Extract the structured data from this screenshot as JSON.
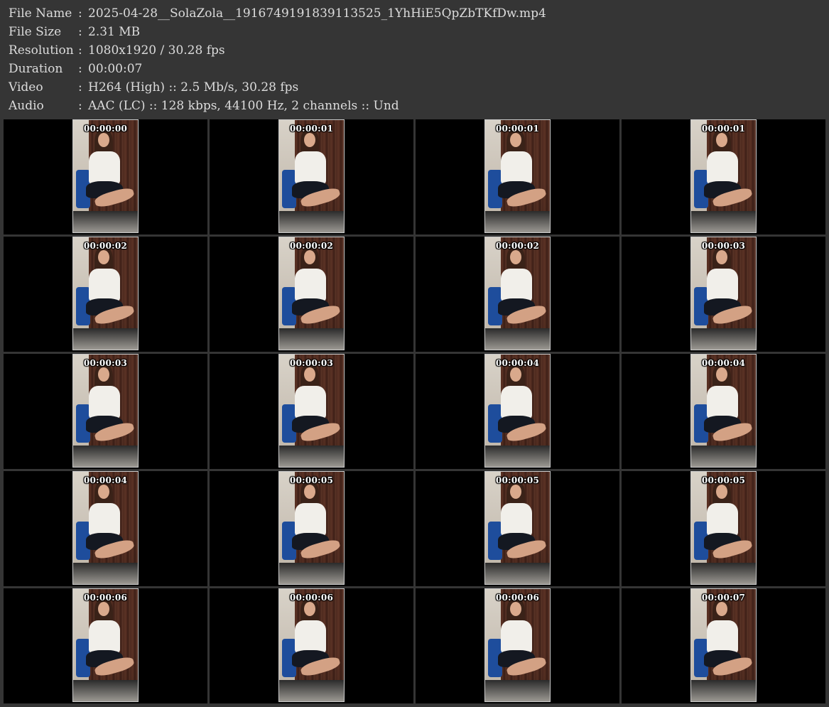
{
  "info": [
    {
      "label": "File Name",
      "value": "2025-04-28__SolaZola__1916749191839113525_1YhHiE5QpZbTKfDw.mp4"
    },
    {
      "label": "File Size",
      "value": "2.31 MB"
    },
    {
      "label": "Resolution",
      "value": "1080x1920 / 30.28 fps"
    },
    {
      "label": "Duration",
      "value": "00:00:07"
    },
    {
      "label": "Video",
      "value": "H264 (High) :: 2.5 Mb/s, 30.28 fps"
    },
    {
      "label": "Audio",
      "value": "AAC (LC) :: 128 kbps, 44100 Hz, 2 channels :: Und"
    }
  ],
  "separator": ":",
  "thumbnails": [
    {
      "timestamp": "00:00:00"
    },
    {
      "timestamp": "00:00:01"
    },
    {
      "timestamp": "00:00:01"
    },
    {
      "timestamp": "00:00:01"
    },
    {
      "timestamp": "00:00:02"
    },
    {
      "timestamp": "00:00:02"
    },
    {
      "timestamp": "00:00:02"
    },
    {
      "timestamp": "00:00:03"
    },
    {
      "timestamp": "00:00:03"
    },
    {
      "timestamp": "00:00:03"
    },
    {
      "timestamp": "00:00:04"
    },
    {
      "timestamp": "00:00:04"
    },
    {
      "timestamp": "00:00:04"
    },
    {
      "timestamp": "00:00:05"
    },
    {
      "timestamp": "00:00:05"
    },
    {
      "timestamp": "00:00:05"
    },
    {
      "timestamp": "00:00:06"
    },
    {
      "timestamp": "00:00:06"
    },
    {
      "timestamp": "00:00:06"
    },
    {
      "timestamp": "00:00:07"
    }
  ]
}
